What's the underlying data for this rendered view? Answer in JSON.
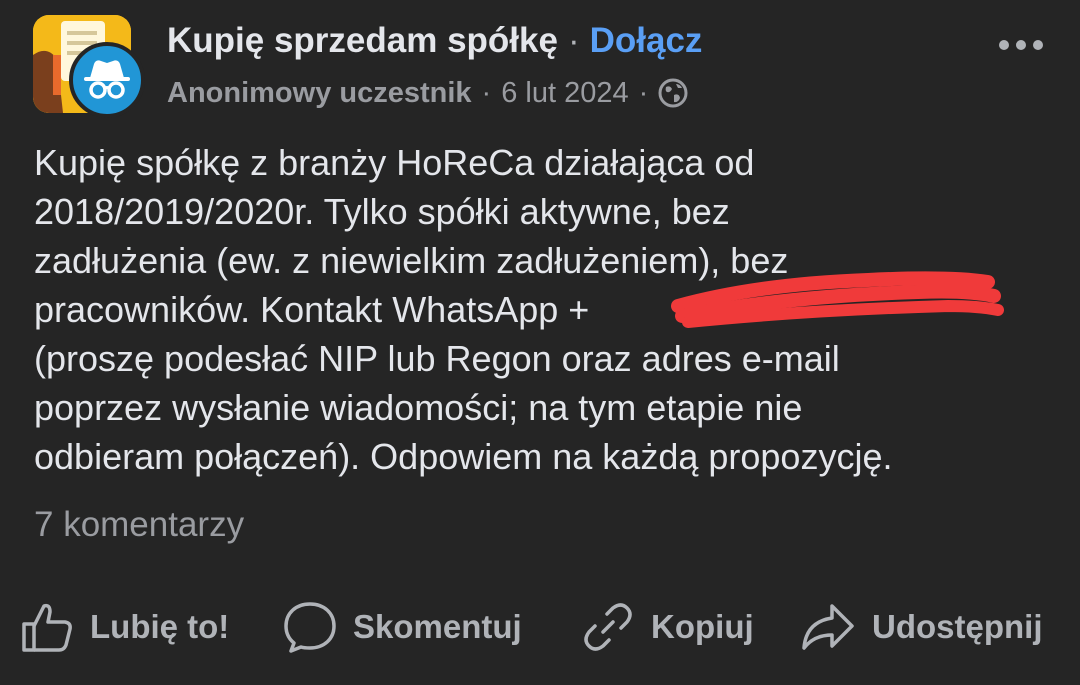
{
  "header": {
    "group_name": "Kupię sprzedam spółkę",
    "separator": "·",
    "join_label": "Dołącz",
    "author": "Anonimowy uczestnik",
    "dot": "·",
    "date": "6 lut 2024",
    "dot2": "·",
    "privacy_icon": "globe-icon",
    "more_icon": "more-horizontal-icon"
  },
  "post": {
    "lines": [
      "Kupię spółkę z branży HoReCa działająca od",
      "2018/2019/2020r. Tylko spółki aktywne, bez",
      "zadłużenia (ew. z niewielkim zadłużeniem), bez",
      "pracowników. Kontakt WhatsApp +",
      "(proszę podesłać NIP lub Regon oraz adres e-mail",
      "poprzez wysłanie wiadomości; na tym etapie nie",
      "odbieram połączeń). Odpowiem na każdą propozycję."
    ]
  },
  "footer": {
    "comments": "7 komentarzy"
  },
  "actions": {
    "like": "Lubię to!",
    "comment": "Skomentuj",
    "copy": "Kopiuj",
    "share": "Udostępnij"
  },
  "colors": {
    "background": "#252525",
    "text": "#e4e6eb",
    "secondary": "#9a9ca1",
    "link": "#5a9ff5",
    "group_avatar": "#f4b919",
    "anon_badge": "#2196d6",
    "redaction": "#f03a3a"
  }
}
